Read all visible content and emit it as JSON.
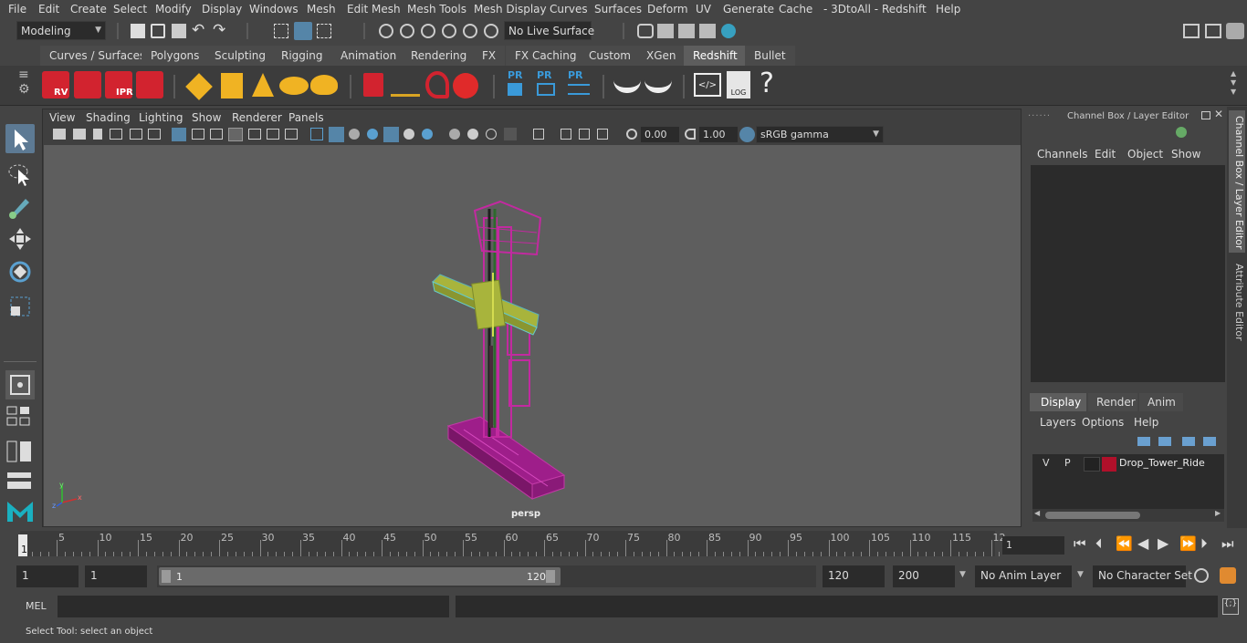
{
  "menubar": {
    "items": [
      "File",
      "Edit",
      "Create",
      "Select",
      "Modify",
      "Display",
      "Windows",
      "Mesh",
      "Edit Mesh",
      "Mesh Tools",
      "Mesh Display",
      "Curves",
      "Surfaces",
      "Deform",
      "UV",
      "Generate",
      "Cache",
      "- 3DtoAll -",
      "Redshift",
      "Help"
    ]
  },
  "statusline": {
    "mode": "Modeling",
    "live_surface": "No Live Surface"
  },
  "shelf": {
    "tabs": [
      "Curves / Surfaces",
      "Polygons",
      "Sculpting",
      "Rigging",
      "Animation",
      "Rendering",
      "FX",
      "FX Caching",
      "Custom",
      "XGen",
      "Redshift",
      "Bullet"
    ],
    "active_tab": "Redshift",
    "icon_labels": {
      "rv": "RV",
      "ipr": "IPR",
      "pr": "PR",
      "log": "LOG",
      "help": "?"
    }
  },
  "viewport": {
    "menu": [
      "View",
      "Shading",
      "Lighting",
      "Show",
      "Renderer",
      "Panels"
    ],
    "exposure": "0.00",
    "gamma": "1.00",
    "color_space": "sRGB gamma",
    "camera_label": "persp",
    "axis": {
      "x": "x",
      "y": "y",
      "z": "z"
    }
  },
  "channel_box": {
    "title": "Channel Box / Layer Editor",
    "menu": [
      "Channels",
      "Edit",
      "Object",
      "Show"
    ],
    "layer_tabs": [
      "Display",
      "Render",
      "Anim"
    ],
    "active_layer_tab": "Display",
    "layer_menu": [
      "Layers",
      "Options",
      "Help"
    ],
    "layers": [
      {
        "visible": "V",
        "playback": "P",
        "name": "Drop_Tower_Ride",
        "color": "#b0102a"
      }
    ]
  },
  "side_tabs": [
    "Channel Box / Layer Editor",
    "Attribute Editor"
  ],
  "timeline": {
    "ticks": [
      "5",
      "10",
      "15",
      "20",
      "25",
      "30",
      "35",
      "40",
      "45",
      "50",
      "55",
      "60",
      "65",
      "70",
      "75",
      "80",
      "85",
      "90",
      "95",
      "100",
      "105",
      "110",
      "115",
      "12"
    ],
    "current_frame_marker": "1",
    "current_frame_field": "1"
  },
  "range": {
    "start": "1",
    "playback_start": "1",
    "slider_start": "1",
    "slider_end": "120",
    "playback_end": "120",
    "end": "200",
    "anim_layer": "No Anim Layer",
    "character_set": "No Character Set"
  },
  "command": {
    "language": "MEL"
  },
  "help_line": "Select Tool: select an object"
}
